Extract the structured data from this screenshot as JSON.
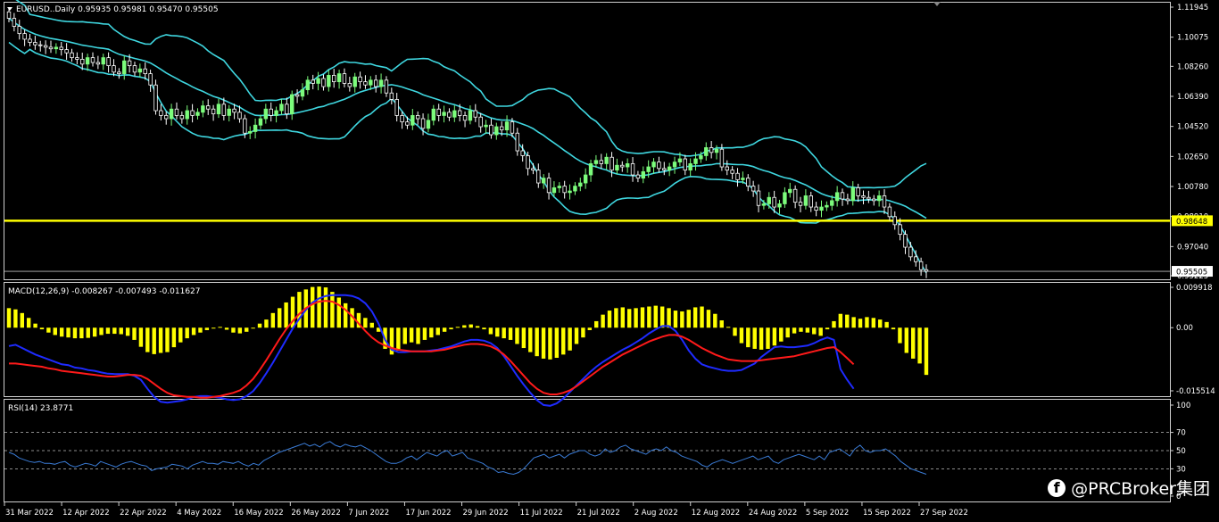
{
  "colors": {
    "bull": "#7CFC7C",
    "bear": "#ffffff",
    "band": "#3fd7e0",
    "hline": "#ffff00",
    "macd_hist": "#ffff00",
    "macd_line": "#1e2bff",
    "signal_line": "#ff1a1a",
    "rsi_line": "#3a7bd5",
    "frame": "#cfcfcf"
  },
  "main": {
    "title": "EURUSD..Daily  0.95935 0.95981 0.95470 0.95505",
    "level_label": "0.98648",
    "last_label": "0.95505",
    "y_ticks": [
      "1.11945",
      "1.10075",
      "1.08260",
      "1.06390",
      "1.04520",
      "1.02650",
      "1.00780",
      "0.98910",
      "0.97040",
      "0.95225"
    ]
  },
  "macd": {
    "title": "MACD(12,26,9) -0.008267 -0.007493 -0.011627",
    "y_ticks": [
      "0.009918",
      "0.00",
      "-0.015514"
    ]
  },
  "rsi": {
    "title": "RSI(14) 23.8771",
    "y_ticks": [
      "100",
      "70",
      "50",
      "30",
      "0"
    ]
  },
  "x_labels": [
    "31 Mar 2022",
    "12 Apr 2022",
    "22 Apr 2022",
    "4 May 2022",
    "16 May 2022",
    "26 May 2022",
    "7 Jun 2022",
    "17 Jun 2022",
    "29 Jun 2022",
    "11 Jul 2022",
    "21 Jul 2022",
    "2 Aug 2022",
    "12 Aug 2022",
    "24 Aug 2022",
    "5 Sep 2022",
    "15 Sep 2022",
    "27 Sep 2022"
  ],
  "watermark": {
    "icon": "f",
    "text": "@PRCBroker集团"
  },
  "chart_data": [
    {
      "type": "candlestick",
      "title": "EURUSD..Daily",
      "ylim": [
        0.95225,
        1.11945
      ],
      "horizontal_level": 0.98648,
      "bollinger_bands": true,
      "close": [
        1.1125,
        1.1075,
        1.103,
        1.0995,
        1.0975,
        1.096,
        1.0955,
        1.0945,
        1.0935,
        1.0945,
        1.093,
        1.091,
        1.088,
        1.087,
        1.084,
        1.088,
        1.085,
        1.084,
        1.088,
        1.083,
        1.079,
        1.078,
        1.086,
        1.083,
        1.079,
        1.081,
        1.078,
        1.071,
        1.055,
        1.052,
        1.05,
        1.056,
        1.052,
        1.05,
        1.055,
        1.052,
        1.054,
        1.058,
        1.056,
        1.053,
        1.059,
        1.052,
        1.056,
        1.054,
        1.05,
        1.041,
        1.042,
        1.046,
        1.05,
        1.056,
        1.052,
        1.055,
        1.059,
        1.053,
        1.065,
        1.064,
        1.068,
        1.074,
        1.072,
        1.075,
        1.07,
        1.077,
        1.073,
        1.078,
        1.072,
        1.07,
        1.076,
        1.073,
        1.071,
        1.074,
        1.07,
        1.074,
        1.066,
        1.062,
        1.052,
        1.048,
        1.046,
        1.052,
        1.05,
        1.044,
        1.049,
        1.056,
        1.052,
        1.054,
        1.051,
        1.055,
        1.052,
        1.049,
        1.055,
        1.051,
        1.045,
        1.046,
        1.04,
        1.045,
        1.043,
        1.048,
        1.041,
        1.03,
        1.027,
        1.019,
        1.018,
        1.01,
        1.013,
        1.004,
        1.007,
        1.008,
        1.004,
        1.005,
        1.008,
        1.01,
        1.015,
        1.022,
        1.024,
        1.022,
        1.026,
        1.018,
        1.021,
        1.02,
        1.022,
        1.015,
        1.013,
        1.017,
        1.02,
        1.023,
        1.019,
        1.018,
        1.02,
        1.023,
        1.025,
        1.018,
        1.022,
        1.025,
        1.027,
        1.032,
        1.029,
        1.031,
        1.02,
        1.018,
        1.016,
        1.012,
        1.013,
        1.008,
        1.005,
        0.996,
        0.997,
        1.001,
        0.995,
        0.997,
        1.004,
        1.006,
        0.998,
        0.996,
        1.002,
        0.995,
        0.993,
        0.995,
        0.996,
        0.999,
        1.004,
        1.0,
        0.999,
        1.007,
        1.002,
        1.001,
        1.0,
        0.999,
        1.002,
        0.995,
        0.989,
        0.984,
        0.978,
        0.97,
        0.964,
        0.961,
        0.956,
        0.955
      ]
    },
    {
      "type": "bar",
      "title": "MACD(12,26,9)",
      "ylim": [
        -0.015514,
        0.009918
      ],
      "histogram": [
        0.0048,
        0.0045,
        0.0036,
        0.0024,
        0.001,
        -0.0004,
        -0.0012,
        -0.0018,
        -0.0022,
        -0.0024,
        -0.0026,
        -0.0026,
        -0.0025,
        -0.0022,
        -0.0018,
        -0.0015,
        -0.0015,
        -0.0016,
        -0.002,
        -0.003,
        -0.0047,
        -0.006,
        -0.0065,
        -0.0062,
        -0.006,
        -0.0048,
        -0.0036,
        -0.0026,
        -0.0018,
        -0.0012,
        -0.0006,
        -0.0002,
        0.0002,
        -0.0005,
        -0.0012,
        -0.0014,
        -0.001,
        -0.0002,
        0.001,
        0.002,
        0.0036,
        0.0048,
        0.0062,
        0.0076,
        0.0088,
        0.0094,
        0.01,
        0.0101,
        0.0099,
        0.0088,
        0.0074,
        0.006,
        0.0048,
        0.0036,
        0.0024,
        0.0012,
        -0.001,
        -0.0052,
        -0.0066,
        -0.0056,
        -0.004,
        -0.0036,
        -0.004,
        -0.003,
        -0.0024,
        -0.0018,
        -0.001,
        -0.0004,
        0.0002,
        0.0006,
        0.0008,
        0.0004,
        -0.0004,
        -0.0016,
        -0.0022,
        -0.0026,
        -0.003,
        -0.004,
        -0.005,
        -0.006,
        -0.007,
        -0.0076,
        -0.0078,
        -0.0074,
        -0.0066,
        -0.0056,
        -0.004,
        -0.0024,
        -0.0006,
        0.0016,
        0.0032,
        0.0042,
        0.0048,
        0.005,
        0.0046,
        0.0048,
        0.005,
        0.0052,
        0.0054,
        0.0052,
        0.0048,
        0.0042,
        0.004,
        0.0044,
        0.005,
        0.0052,
        0.0044,
        0.0034,
        0.0018,
        0.0002,
        -0.002,
        -0.0038,
        -0.0048,
        -0.0052,
        -0.0054,
        -0.0052,
        -0.0044,
        -0.0034,
        -0.0024,
        -0.0014,
        -0.001,
        -0.0012,
        -0.0016,
        -0.002,
        -0.0004,
        0.0016,
        0.0034,
        0.0032,
        0.0026,
        0.0022,
        0.0026,
        0.0024,
        0.002,
        0.0014,
        -0.0004,
        -0.0038,
        -0.0062,
        -0.0076,
        -0.0088,
        -0.0116
      ],
      "macd_line": [
        -0.0045,
        -0.0042,
        -0.005,
        -0.0058,
        -0.0066,
        -0.0072,
        -0.0078,
        -0.0084,
        -0.009,
        -0.0092,
        -0.0098,
        -0.01,
        -0.0104,
        -0.0106,
        -0.011,
        -0.0113,
        -0.0114,
        -0.0114,
        -0.0114,
        -0.0118,
        -0.0128,
        -0.015,
        -0.017,
        -0.0182,
        -0.0184,
        -0.0182,
        -0.018,
        -0.0176,
        -0.017,
        -0.0168,
        -0.0168,
        -0.017,
        -0.0172,
        -0.0176,
        -0.0178,
        -0.0176,
        -0.0168,
        -0.0156,
        -0.0136,
        -0.0112,
        -0.0086,
        -0.0058,
        -0.003,
        -0.0002,
        0.0022,
        0.0044,
        0.0062,
        0.0072,
        0.0078,
        0.008,
        0.008,
        0.008,
        0.0078,
        0.0072,
        0.006,
        0.004,
        0.001,
        -0.003,
        -0.0054,
        -0.006,
        -0.006,
        -0.0058,
        -0.0058,
        -0.0058,
        -0.0056,
        -0.0054,
        -0.005,
        -0.0046,
        -0.004,
        -0.0034,
        -0.003,
        -0.003,
        -0.0032,
        -0.0038,
        -0.005,
        -0.007,
        -0.0094,
        -0.0118,
        -0.014,
        -0.016,
        -0.0178,
        -0.019,
        -0.0192,
        -0.0186,
        -0.0174,
        -0.0158,
        -0.0142,
        -0.0126,
        -0.011,
        -0.0096,
        -0.0084,
        -0.0074,
        -0.0064,
        -0.0054,
        -0.0046,
        -0.0036,
        -0.0026,
        -0.0014,
        -0.0004,
        0.0004,
        0.0004,
        -0.0008,
        -0.003,
        -0.0056,
        -0.0076,
        -0.009,
        -0.0096,
        -0.01,
        -0.0104,
        -0.0106,
        -0.0106,
        -0.0104,
        -0.0096,
        -0.0088,
        -0.0072,
        -0.006,
        -0.0048,
        -0.0046,
        -0.0048,
        -0.0048,
        -0.0046,
        -0.0044,
        -0.0038,
        -0.003,
        -0.0024,
        -0.003,
        -0.0102,
        -0.0128,
        -0.015
      ],
      "signal_line": [
        -0.0088,
        -0.0088,
        -0.009,
        -0.0092,
        -0.0094,
        -0.0096,
        -0.01,
        -0.0102,
        -0.0106,
        -0.0108,
        -0.011,
        -0.0112,
        -0.0114,
        -0.0116,
        -0.0118,
        -0.012,
        -0.012,
        -0.0118,
        -0.0116,
        -0.0116,
        -0.0118,
        -0.0126,
        -0.0138,
        -0.015,
        -0.016,
        -0.0166,
        -0.0168,
        -0.017,
        -0.017,
        -0.0172,
        -0.0172,
        -0.017,
        -0.0168,
        -0.0164,
        -0.016,
        -0.0154,
        -0.0142,
        -0.0126,
        -0.0104,
        -0.008,
        -0.0054,
        -0.0028,
        -0.0004,
        0.0016,
        0.0034,
        0.0048,
        0.0058,
        0.0064,
        0.0066,
        0.0064,
        0.0056,
        0.0044,
        0.0028,
        0.001,
        -0.0008,
        -0.0024,
        -0.0036,
        -0.0044,
        -0.005,
        -0.0054,
        -0.0056,
        -0.0058,
        -0.0058,
        -0.0058,
        -0.0058,
        -0.0056,
        -0.0054,
        -0.005,
        -0.0046,
        -0.0042,
        -0.004,
        -0.004,
        -0.0042,
        -0.0046,
        -0.0054,
        -0.0066,
        -0.0082,
        -0.01,
        -0.0118,
        -0.0136,
        -0.015,
        -0.016,
        -0.0164,
        -0.0164,
        -0.016,
        -0.0154,
        -0.0144,
        -0.0132,
        -0.012,
        -0.0108,
        -0.0096,
        -0.0086,
        -0.0076,
        -0.0066,
        -0.0058,
        -0.005,
        -0.0042,
        -0.0034,
        -0.0028,
        -0.0022,
        -0.0018,
        -0.0018,
        -0.0022,
        -0.003,
        -0.004,
        -0.005,
        -0.0058,
        -0.0066,
        -0.0072,
        -0.0078,
        -0.008,
        -0.0082,
        -0.0082,
        -0.0082,
        -0.008,
        -0.0078,
        -0.0076,
        -0.0074,
        -0.0072,
        -0.007,
        -0.0066,
        -0.0062,
        -0.0058,
        -0.0054,
        -0.005,
        -0.0048,
        -0.006,
        -0.0075,
        -0.009
      ]
    },
    {
      "type": "line",
      "title": "RSI(14)",
      "ylim": [
        0,
        100
      ],
      "levels": [
        70,
        50,
        30
      ],
      "values": [
        48,
        46,
        42,
        40,
        38,
        37,
        38,
        36,
        36,
        35,
        37,
        38,
        34,
        32,
        34,
        36,
        35,
        33,
        38,
        36,
        34,
        32,
        35,
        37,
        38,
        36,
        34,
        33,
        28,
        30,
        31,
        32,
        35,
        34,
        33,
        30,
        34,
        36,
        38,
        36,
        36,
        35,
        38,
        37,
        36,
        38,
        35,
        33,
        36,
        34,
        39,
        42,
        45,
        48,
        50,
        52,
        54,
        56,
        58,
        55,
        57,
        54,
        58,
        60,
        56,
        54,
        57,
        55,
        54,
        56,
        53,
        50,
        46,
        42,
        38,
        36,
        36,
        38,
        42,
        44,
        40,
        44,
        48,
        46,
        44,
        48,
        50,
        44,
        46,
        48,
        42,
        40,
        38,
        36,
        32,
        30,
        26,
        27,
        25,
        24,
        26,
        30,
        36,
        42,
        44,
        46,
        42,
        44,
        46,
        42,
        46,
        48,
        50,
        50,
        46,
        44,
        46,
        52,
        48,
        50,
        54,
        56,
        52,
        50,
        48,
        46,
        50,
        52,
        50,
        54,
        50,
        48,
        44,
        42,
        40,
        38,
        34,
        32,
        36,
        38,
        40,
        38,
        36,
        38,
        40,
        42,
        44,
        40,
        42,
        44,
        38,
        36,
        40,
        42,
        44,
        46,
        44,
        42,
        40,
        44,
        40,
        48,
        50,
        52,
        48,
        44,
        52,
        56,
        50,
        48,
        50,
        50,
        52,
        48,
        44,
        38,
        34,
        30,
        28,
        26,
        24
      ]
    }
  ]
}
